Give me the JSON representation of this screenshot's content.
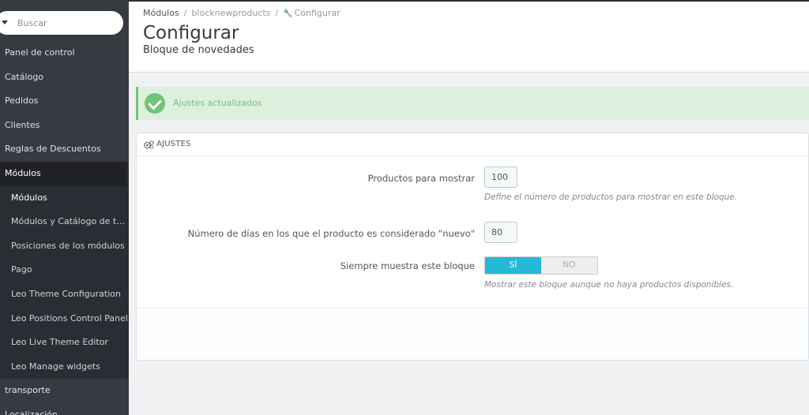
{
  "sidebar": {
    "search": {
      "placeholder": "Buscar"
    },
    "items": [
      {
        "label": "Panel de control"
      },
      {
        "label": "Catálogo"
      },
      {
        "label": "Pedidos"
      },
      {
        "label": "Clientes"
      },
      {
        "label": "Reglas de Descuentos"
      },
      {
        "label": "Módulos"
      }
    ],
    "submenu": [
      {
        "label": "Módulos"
      },
      {
        "label": "Módulos y Catálogo de temas"
      },
      {
        "label": "Posiciones de los módulos"
      },
      {
        "label": "Pago"
      },
      {
        "label": "Leo Theme Configuration"
      },
      {
        "label": "Leo Positions Control Panel"
      },
      {
        "label": "Leo Live Theme Editor"
      },
      {
        "label": "Leo Manage widgets"
      }
    ],
    "after": [
      {
        "label": "transporte"
      },
      {
        "label": "Localización"
      }
    ]
  },
  "breadcrumb": {
    "first": "Módulos",
    "second": "blocknewproducts",
    "third": "Configurar"
  },
  "header": {
    "title": "Configurar",
    "subtitle": "Bloque de novedades"
  },
  "alert": {
    "text": "Ajustes actualizados"
  },
  "panel": {
    "title": "AJUSTES",
    "fields": {
      "products": {
        "label": "Productos para mostrar",
        "value": "100",
        "help": "Define el número de productos para mostrar en este bloque."
      },
      "days": {
        "label": "Número de días en los que el producto es considerado \"nuevo\"",
        "value": "80"
      },
      "always": {
        "label": "Siempre muestra este bloque",
        "yes": "SÍ",
        "no": "NO",
        "help": "Mostrar este bloque aunque no haya productos disponibles."
      }
    }
  },
  "colors": {
    "sidebar_bg": "#363a41",
    "accent": "#25b9d7",
    "success": "#72c279"
  }
}
